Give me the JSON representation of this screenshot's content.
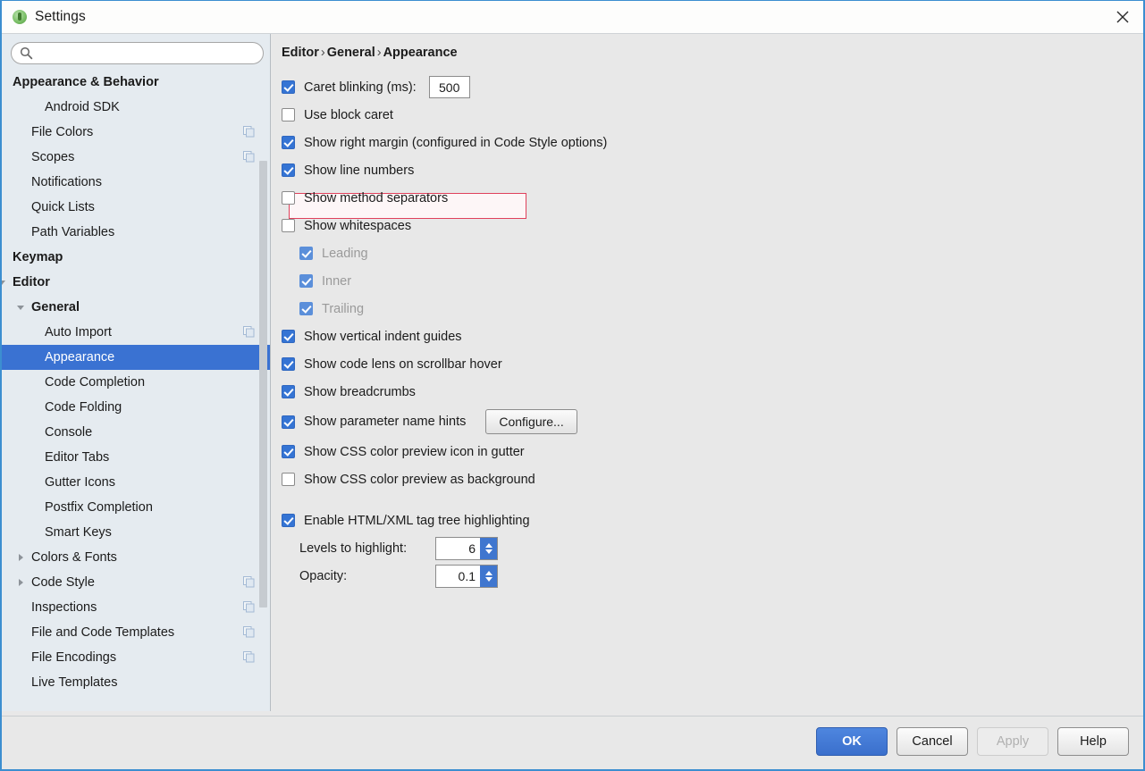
{
  "window": {
    "title": "Settings",
    "app_icon": "android-studio-icon",
    "close_icon": "close-icon",
    "accent_border": "#3c8ed0"
  },
  "sidebar": {
    "search": {
      "value": "",
      "placeholder": "",
      "icon": "search-icon"
    },
    "selection_color": "#3a72d2",
    "items": [
      {
        "label": "Appearance & Behavior",
        "indent": 0,
        "bold": true,
        "twisty": "none",
        "badge": false
      },
      {
        "label": "Android SDK",
        "indent": 2,
        "bold": false,
        "twisty": "none",
        "badge": false
      },
      {
        "label": "File Colors",
        "indent": 1,
        "bold": false,
        "twisty": "none",
        "badge": true
      },
      {
        "label": "Scopes",
        "indent": 1,
        "bold": false,
        "twisty": "none",
        "badge": true
      },
      {
        "label": "Notifications",
        "indent": 1,
        "bold": false,
        "twisty": "none",
        "badge": false
      },
      {
        "label": "Quick Lists",
        "indent": 1,
        "bold": false,
        "twisty": "none",
        "badge": false
      },
      {
        "label": "Path Variables",
        "indent": 1,
        "bold": false,
        "twisty": "none",
        "badge": false
      },
      {
        "label": "Keymap",
        "indent": 0,
        "bold": true,
        "twisty": "none",
        "badge": false
      },
      {
        "label": "Editor",
        "indent": 0,
        "bold": true,
        "twisty": "down",
        "badge": false
      },
      {
        "label": "General",
        "indent": 1,
        "bold": true,
        "twisty": "down",
        "badge": false
      },
      {
        "label": "Auto Import",
        "indent": 2,
        "bold": false,
        "twisty": "none",
        "badge": true
      },
      {
        "label": "Appearance",
        "indent": 2,
        "bold": false,
        "twisty": "none",
        "badge": false,
        "selected": true
      },
      {
        "label": "Code Completion",
        "indent": 2,
        "bold": false,
        "twisty": "none",
        "badge": false
      },
      {
        "label": "Code Folding",
        "indent": 2,
        "bold": false,
        "twisty": "none",
        "badge": false
      },
      {
        "label": "Console",
        "indent": 2,
        "bold": false,
        "twisty": "none",
        "badge": false
      },
      {
        "label": "Editor Tabs",
        "indent": 2,
        "bold": false,
        "twisty": "none",
        "badge": false
      },
      {
        "label": "Gutter Icons",
        "indent": 2,
        "bold": false,
        "twisty": "none",
        "badge": false
      },
      {
        "label": "Postfix Completion",
        "indent": 2,
        "bold": false,
        "twisty": "none",
        "badge": false
      },
      {
        "label": "Smart Keys",
        "indent": 2,
        "bold": false,
        "twisty": "none",
        "badge": false
      },
      {
        "label": "Colors & Fonts",
        "indent": 1,
        "bold": false,
        "twisty": "right",
        "badge": false
      },
      {
        "label": "Code Style",
        "indent": 1,
        "bold": false,
        "twisty": "right",
        "badge": true
      },
      {
        "label": "Inspections",
        "indent": 1,
        "bold": false,
        "twisty": "none",
        "badge": true
      },
      {
        "label": "File and Code Templates",
        "indent": 1,
        "bold": false,
        "twisty": "none",
        "badge": true
      },
      {
        "label": "File Encodings",
        "indent": 1,
        "bold": false,
        "twisty": "none",
        "badge": true
      },
      {
        "label": "Live Templates",
        "indent": 1,
        "bold": false,
        "twisty": "none",
        "badge": false
      }
    ]
  },
  "main": {
    "breadcrumb": {
      "part1": "Editor",
      "part2": "General",
      "part3": "Appearance",
      "separator": "›"
    },
    "highlight_color": "#e0415c",
    "options": {
      "caret_blinking": {
        "label": "Caret blinking (ms):",
        "checked": true,
        "value": "500"
      },
      "use_block_caret": {
        "label": "Use block caret",
        "checked": false
      },
      "show_right_margin": {
        "label": "Show right margin (configured in Code Style options)",
        "checked": true
      },
      "show_line_numbers": {
        "label": "Show line numbers",
        "checked": true,
        "highlighted": true
      },
      "show_method_separators": {
        "label": "Show method separators",
        "checked": false
      },
      "show_whitespaces": {
        "label": "Show whitespaces",
        "checked": false
      },
      "leading": {
        "label": "Leading",
        "checked": true,
        "disabled": true
      },
      "inner": {
        "label": "Inner",
        "checked": true,
        "disabled": true
      },
      "trailing": {
        "label": "Trailing",
        "checked": true,
        "disabled": true
      },
      "vertical_indent_guides": {
        "label": "Show vertical indent guides",
        "checked": true
      },
      "code_lens": {
        "label": "Show code lens on scrollbar hover",
        "checked": true
      },
      "breadcrumbs": {
        "label": "Show breadcrumbs",
        "checked": true
      },
      "param_name_hints": {
        "label": "Show parameter name hints",
        "checked": true,
        "button": "Configure..."
      },
      "css_icon_gutter": {
        "label": "Show CSS color preview icon in gutter",
        "checked": true
      },
      "css_background": {
        "label": "Show CSS color preview as background",
        "checked": false
      },
      "html_tag_tree": {
        "label": "Enable HTML/XML tag tree highlighting",
        "checked": true
      },
      "levels_to_highlight": {
        "label": "Levels to highlight:",
        "value": "6"
      },
      "opacity": {
        "label": "Opacity:",
        "value": "0.1"
      }
    }
  },
  "footer": {
    "ok": "OK",
    "cancel": "Cancel",
    "apply": "Apply",
    "help": "Help",
    "apply_disabled": true
  }
}
